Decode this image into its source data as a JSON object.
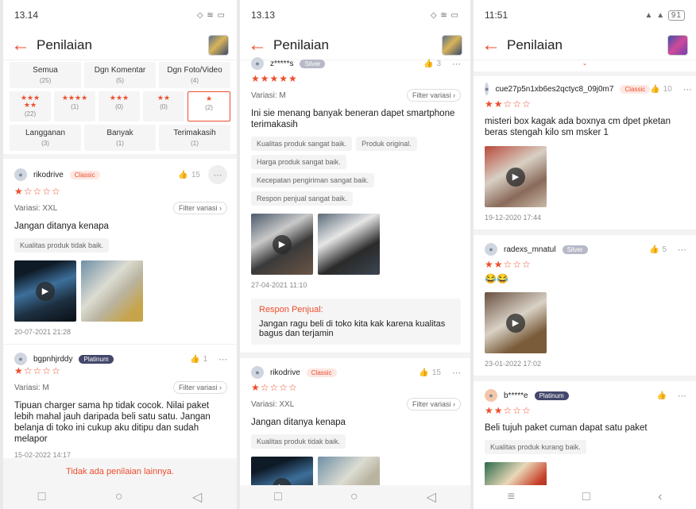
{
  "title": "Penilaian",
  "statusbar": {
    "p1_time": "13.14",
    "p2_time": "13.13",
    "p3_time": "11:51",
    "p3_battery": "91"
  },
  "filters": {
    "row1": [
      {
        "label": "Semua",
        "count": "(25)"
      },
      {
        "label": "Dgn Komentar",
        "count": "(5)"
      },
      {
        "label": "Dgn Foto/Video",
        "count": "(4)"
      }
    ],
    "row2": [
      {
        "stars": "★★★\n★★",
        "count": "(22)"
      },
      {
        "stars": "★★★★",
        "count": "(1)"
      },
      {
        "stars": "★★★",
        "count": "(0)"
      },
      {
        "stars": "★★",
        "count": "(0)"
      },
      {
        "stars": "★",
        "count": "(2)"
      }
    ],
    "row3": [
      {
        "label": "Langganan",
        "count": "(3)"
      },
      {
        "label": "Banyak",
        "count": "(1)"
      },
      {
        "label": "Terimakasih",
        "count": "(1)"
      }
    ]
  },
  "filter_label": "Filter variasi",
  "p1": {
    "r1": {
      "user": "rikodrive",
      "badge": "Classic",
      "likes": "15",
      "stars": "★☆☆☆☆",
      "variasi": "Variasi: XXL",
      "text": "Jangan ditanya kenapa",
      "tags": [
        "Kualitas produk tidak baik."
      ],
      "date": "20-07-2021 21:28"
    },
    "r2": {
      "user": "bgpnhjrddy",
      "badge": "Platinum",
      "likes": "1",
      "stars": "★☆☆☆☆",
      "variasi": "Variasi: M",
      "text": "Tipuan charger sama hp tidak cocok. Nilai paket lebih mahal jauh daripada beli satu satu. Jangan belanja di toko ini cukup aku ditipu dan sudah melapor",
      "date": "15-02-2022 14:17"
    },
    "footer": "Tidak ada penilaian lainnya."
  },
  "p2": {
    "r1": {
      "user": "z*****s",
      "badge": "Silver",
      "likes": "3",
      "stars": "★★★★★",
      "variasi": "Variasi: M",
      "text": "Ini sie menang banyak beneran dapet smartphone terimakasih",
      "tags": [
        "Kualitas produk sangat baik.",
        "Produk original.",
        "Harga produk sangat baik.",
        "Kecepatan pengiriman sangat baik.",
        "Respon penjual sangat baik."
      ],
      "date": "27-04-2021 11:10",
      "respon_title": "Respon Penjual:",
      "respon_text": "Jangan ragu beli di toko kita kak karena kualitas bagus dan terjamin"
    },
    "r2": {
      "user": "rikodrive",
      "badge": "Classic",
      "likes": "15",
      "stars": "★☆☆☆☆",
      "variasi": "Variasi: XXL",
      "text": "Jangan ditanya kenapa",
      "tags": [
        "Kualitas produk tidak baik."
      ]
    }
  },
  "p3": {
    "r1": {
      "user": "cue27p5n1xb6es2qctyc8_09j0m7",
      "badge": "Classic",
      "likes": "10",
      "stars": "★★☆☆☆",
      "text": "misteri box kagak ada boxnya cm dpet pketan beras stengah kilo sm msker 1",
      "date": "19-12-2020 17:44"
    },
    "r2": {
      "user": "radexs_mnatul",
      "badge": "Silver",
      "likes": "5",
      "stars": "★★☆☆☆",
      "emoji": "😂😂",
      "date": "23-01-2022 17:02"
    },
    "r3": {
      "user": "b*****e",
      "badge": "Platinum",
      "stars": "★★☆☆☆",
      "text": "Beli tujuh paket cuman dapat satu paket",
      "tags": [
        "Kualitas produk kurang baik."
      ]
    }
  }
}
